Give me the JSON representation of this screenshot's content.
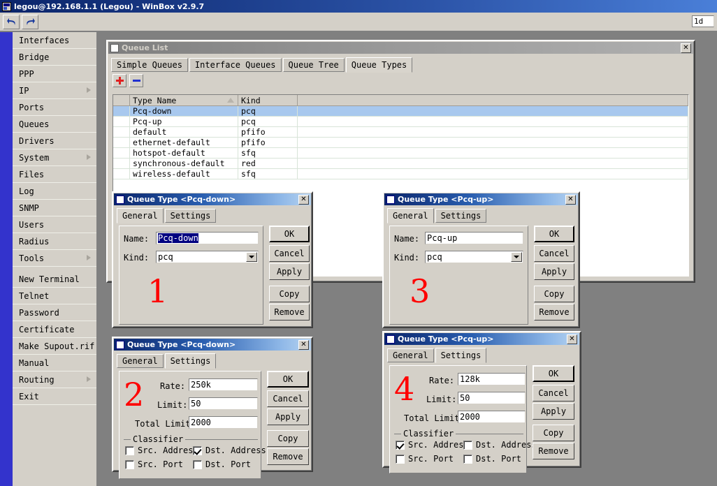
{
  "app": {
    "title": "legou@192.168.1.1 (Legou) - WinBox v2.9.7",
    "toolbar": {
      "undo_label": "undo-icon",
      "redo_label": "redo-icon",
      "right_field_value": "1d"
    }
  },
  "sidebar": {
    "items": [
      {
        "label": "Interfaces",
        "submenu": false
      },
      {
        "label": "Bridge",
        "submenu": false
      },
      {
        "label": "PPP",
        "submenu": false
      },
      {
        "label": "IP",
        "submenu": true
      },
      {
        "label": "Ports",
        "submenu": false
      },
      {
        "label": "Queues",
        "submenu": false
      },
      {
        "label": "Drivers",
        "submenu": false
      },
      {
        "label": "System",
        "submenu": true
      },
      {
        "label": "Files",
        "submenu": false
      },
      {
        "label": "Log",
        "submenu": false
      },
      {
        "label": "SNMP",
        "submenu": false
      },
      {
        "label": "Users",
        "submenu": false
      },
      {
        "label": "Radius",
        "submenu": false
      },
      {
        "label": "Tools",
        "submenu": true
      },
      {
        "label": "New Terminal",
        "submenu": false
      },
      {
        "label": "Telnet",
        "submenu": false
      },
      {
        "label": "Password",
        "submenu": false
      },
      {
        "label": "Certificate",
        "submenu": false
      },
      {
        "label": "Make Supout.rif",
        "submenu": false
      },
      {
        "label": "Manual",
        "submenu": false
      },
      {
        "label": "Routing",
        "submenu": true
      },
      {
        "label": "Exit",
        "submenu": false
      }
    ]
  },
  "queue_list": {
    "title": "Queue List",
    "close_label": "✕",
    "tabs": [
      {
        "label": "Simple Queues",
        "selected": false
      },
      {
        "label": "Interface Queues",
        "selected": false
      },
      {
        "label": "Queue Tree",
        "selected": false
      },
      {
        "label": "Queue Types",
        "selected": true
      }
    ],
    "toolbar": {
      "add_label": "+",
      "remove_label": "-"
    },
    "columns": [
      "",
      "Type Name",
      "Kind",
      ""
    ],
    "sort_column": "Type Name",
    "sort_direction": "ascending",
    "rows": [
      {
        "flag": "",
        "name": "Pcq-down",
        "kind": "pcq",
        "extra": "",
        "selected": true
      },
      {
        "flag": "",
        "name": "Pcq-up",
        "kind": "pcq",
        "extra": "",
        "selected": false
      },
      {
        "flag": "",
        "name": "default",
        "kind": "pfifo",
        "extra": "",
        "selected": false
      },
      {
        "flag": "",
        "name": "ethernet-default",
        "kind": "pfifo",
        "extra": "",
        "selected": false
      },
      {
        "flag": "",
        "name": "hotspot-default",
        "kind": "sfq",
        "extra": "",
        "selected": false
      },
      {
        "flag": "",
        "name": "synchronous-default",
        "kind": "red",
        "extra": "",
        "selected": false
      },
      {
        "flag": "",
        "name": "wireless-default",
        "kind": "sfq",
        "extra": "",
        "selected": false
      }
    ]
  },
  "buttons": {
    "ok": "OK",
    "cancel": "Cancel",
    "apply": "Apply",
    "copy": "Copy",
    "remove": "Remove"
  },
  "dialog1": {
    "marker": "1",
    "title": "Queue Type <Pcq-down>",
    "close_label": "✕",
    "tabs": [
      {
        "label": "General",
        "selected": true
      },
      {
        "label": "Settings",
        "selected": false
      }
    ],
    "name_label": "Name:",
    "name_value": "Pcq-down",
    "kind_label": "Kind:",
    "kind_value": "pcq"
  },
  "dialog2": {
    "marker": "2",
    "title": "Queue Type <Pcq-down>",
    "close_label": "✕",
    "tabs": [
      {
        "label": "General",
        "selected": false
      },
      {
        "label": "Settings",
        "selected": true
      }
    ],
    "rate_label": "Rate:",
    "rate_value": "250k",
    "limit_label": "Limit:",
    "limit_value": "50",
    "total_limit_label": "Total Limit:",
    "total_limit_value": "2000",
    "classifier_label": "Classifier",
    "classifier": [
      {
        "label": "Src. Address",
        "checked": false
      },
      {
        "label": "Dst. Address",
        "checked": true
      },
      {
        "label": "Src. Port",
        "checked": false
      },
      {
        "label": "Dst. Port",
        "checked": false
      }
    ]
  },
  "dialog3": {
    "marker": "3",
    "title": "Queue Type <Pcq-up>",
    "close_label": "✕",
    "tabs": [
      {
        "label": "General",
        "selected": true
      },
      {
        "label": "Settings",
        "selected": false
      }
    ],
    "name_label": "Name:",
    "name_value": "Pcq-up",
    "kind_label": "Kind:",
    "kind_value": "pcq"
  },
  "dialog4": {
    "marker": "4",
    "title": "Queue Type <Pcq-up>",
    "close_label": "✕",
    "tabs": [
      {
        "label": "General",
        "selected": false
      },
      {
        "label": "Settings",
        "selected": true
      }
    ],
    "rate_label": "Rate:",
    "rate_value": "128k",
    "limit_label": "Limit:",
    "limit_value": "50",
    "total_limit_label": "Total Limit:",
    "total_limit_value": "2000",
    "classifier_label": "Classifier",
    "classifier": [
      {
        "label": "Src. Address",
        "checked": true
      },
      {
        "label": "Dst. Address",
        "checked": false
      },
      {
        "label": "Src. Port",
        "checked": false
      },
      {
        "label": "Dst. Port",
        "checked": false
      }
    ]
  },
  "colors": {
    "titlebar_blue": "#0a246a",
    "sidebar_strip": "#3333cc",
    "desktop": "#808080",
    "chrome": "#d4d0c8",
    "selection": "#a8c8ee",
    "marker_red": "#ff0000"
  }
}
